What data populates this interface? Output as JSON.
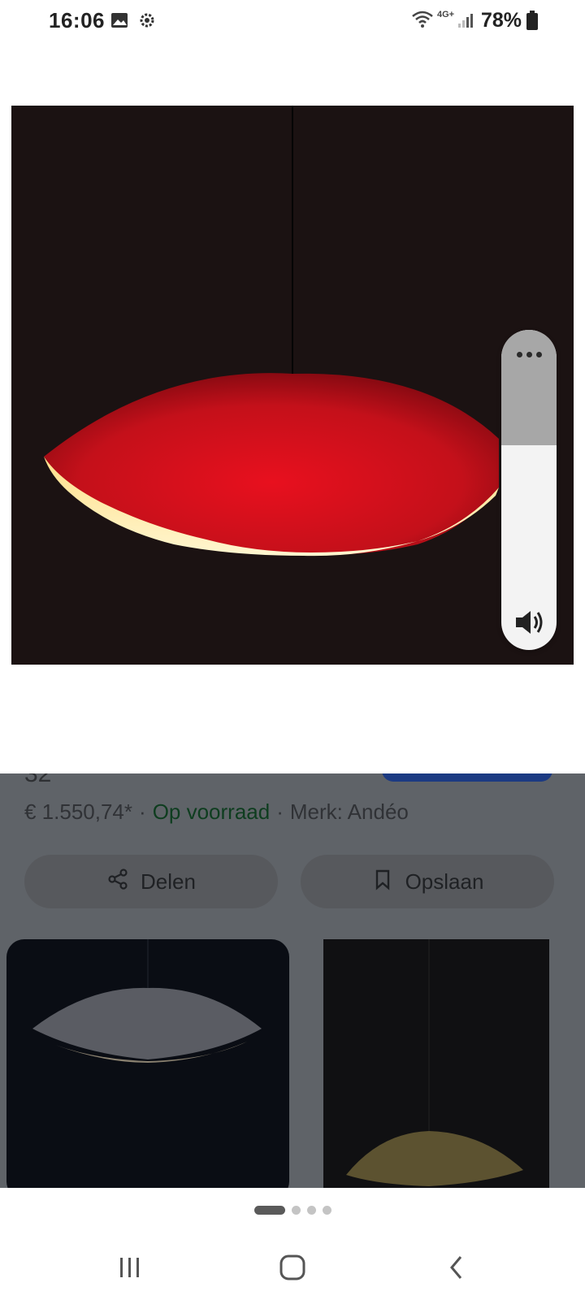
{
  "status_bar": {
    "time": "16:06",
    "network": "4G+",
    "battery": "78%",
    "icons": [
      "gallery-icon",
      "settings-icon",
      "wifi-icon",
      "signal-icon",
      "battery-icon"
    ]
  },
  "viewer": {
    "image_alt": "Red glowing dome pendant lamp on dark background",
    "volume": {
      "more_icon": "more-dots-icon",
      "level": 0.64,
      "speaker_icon": "speaker-icon"
    }
  },
  "product": {
    "title_fragment": "32",
    "price": "€ 1.550,74*",
    "separator": "·",
    "stock": "Op voorraad",
    "brand": "Merk: Andéo",
    "share_label": "Delen",
    "save_label": "Opslaan"
  },
  "pager": {
    "count": 4,
    "active_index": 0
  },
  "navbar": {
    "recents_icon": "recents-icon",
    "home_icon": "home-icon",
    "back_icon": "back-icon"
  },
  "colors": {
    "lamp_red": "#d8121f",
    "photo_bg": "#1b1212",
    "stock_green": "#0e3d1f"
  }
}
